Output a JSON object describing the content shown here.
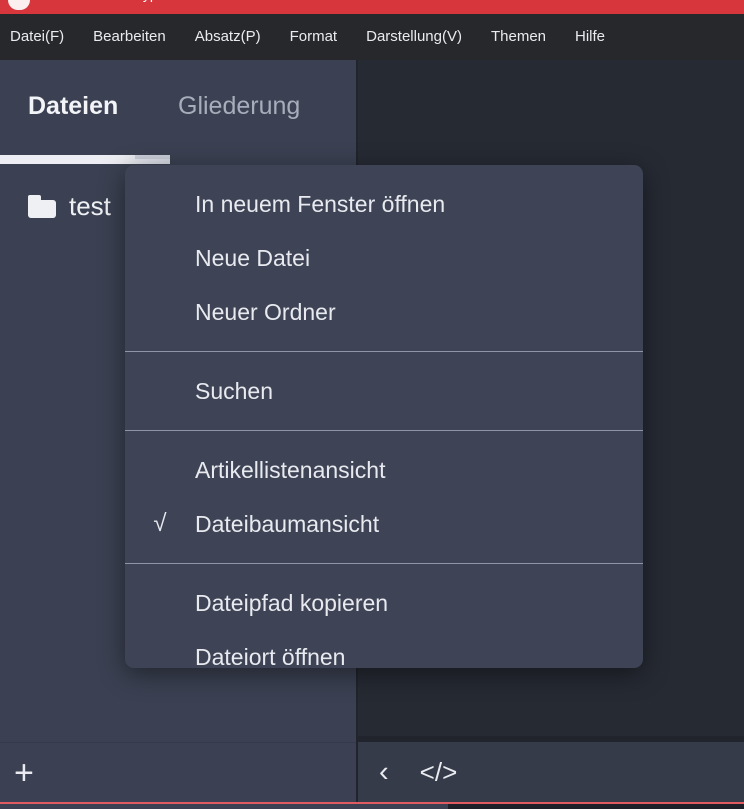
{
  "titlebar": {
    "title": "typ",
    "logo_icon": "app-logo-icon",
    "accent_color": "#d6363c"
  },
  "menubar": {
    "items": [
      {
        "label": "Datei(F)"
      },
      {
        "label": "Bearbeiten"
      },
      {
        "label": "Absatz(P)"
      },
      {
        "label": "Format"
      },
      {
        "label": "Darstellung(V)"
      },
      {
        "label": "Themen"
      },
      {
        "label": "Hilfe"
      }
    ]
  },
  "sidebar": {
    "tabs": [
      {
        "label": "Dateien",
        "active": true
      },
      {
        "label": "Gliederung",
        "active": false
      }
    ],
    "tree": [
      {
        "label": "test",
        "icon": "folder-icon"
      }
    ],
    "toolbar": {
      "add_label": "+",
      "add_icon": "plus-icon"
    }
  },
  "editor": {
    "toolbar": {
      "back_label": "‹",
      "back_icon": "chevron-left-icon",
      "code_label": "</>",
      "code_icon": "code-icon"
    }
  },
  "context_menu": {
    "groups": [
      {
        "items": [
          {
            "label": "In neuem Fenster öffnen",
            "checked": false
          },
          {
            "label": "Neue Datei",
            "checked": false
          },
          {
            "label": "Neuer Ordner",
            "checked": false
          }
        ]
      },
      {
        "items": [
          {
            "label": "Suchen",
            "checked": false
          }
        ]
      },
      {
        "items": [
          {
            "label": "Artikellistenansicht",
            "checked": false
          },
          {
            "label": "Dateibaumansicht",
            "checked": true
          }
        ]
      },
      {
        "items": [
          {
            "label": "Dateipfad kopieren",
            "checked": false
          },
          {
            "label": "Dateiort öffnen",
            "checked": false
          }
        ]
      }
    ],
    "check_glyph": "√"
  },
  "colors": {
    "titlebar": "#d6363c",
    "menubar": "#26282c",
    "sidebar": "#3b4152",
    "editor": "#262a33",
    "menu_surface": "#3e4455",
    "separator": "#8d95a6",
    "text": "#e8eaf0",
    "text_muted": "#a7adba",
    "status_line": "#e05a62"
  }
}
